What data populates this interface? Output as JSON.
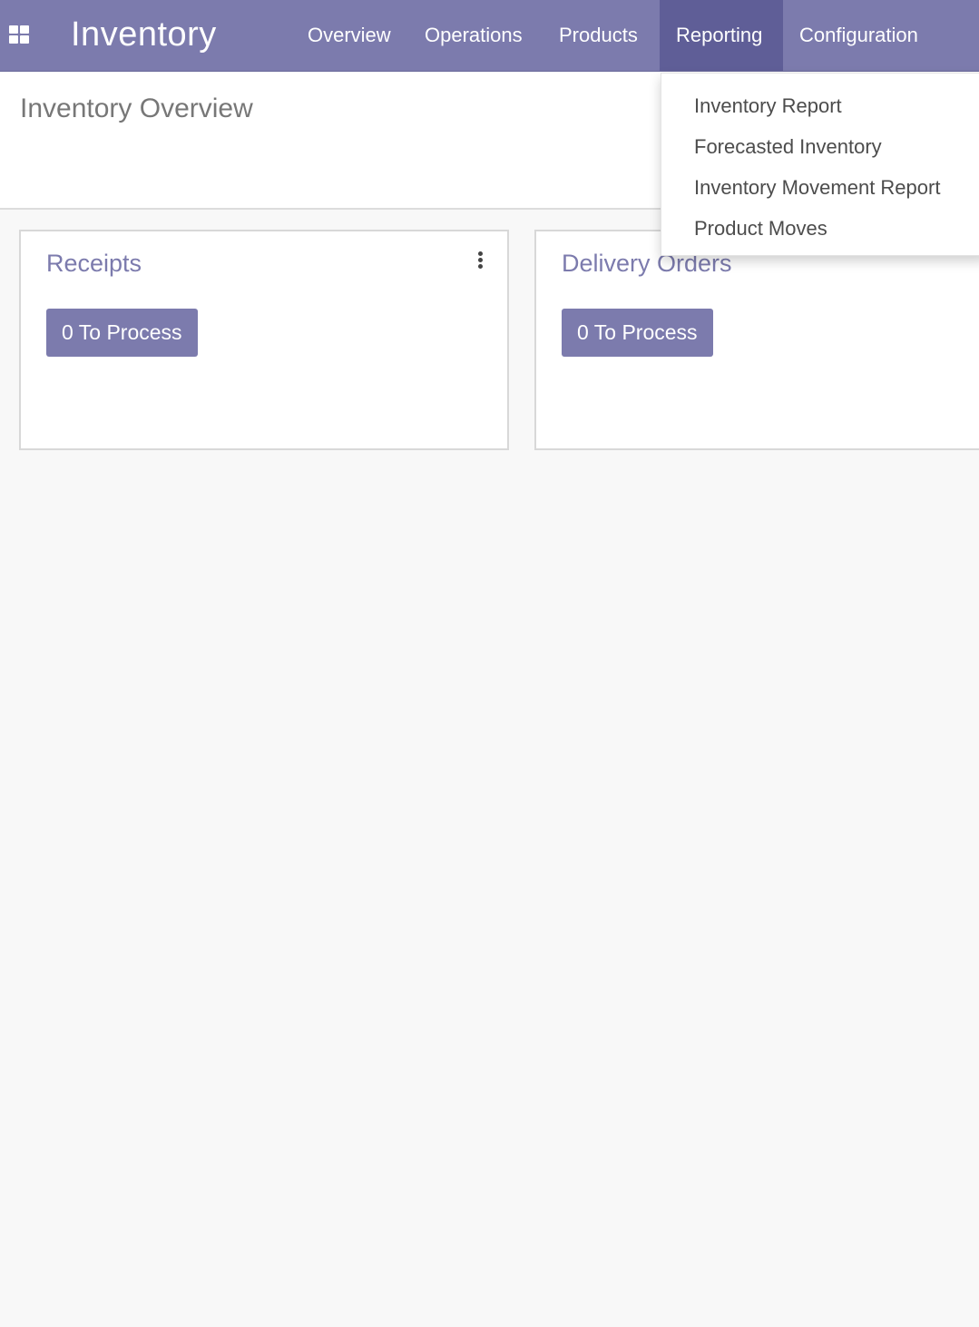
{
  "navbar": {
    "app_name": "Inventory",
    "menu": [
      {
        "label": "Overview"
      },
      {
        "label": "Operations"
      },
      {
        "label": "Products"
      },
      {
        "label": "Reporting"
      },
      {
        "label": "Configuration"
      }
    ],
    "active_menu": "Reporting",
    "apps_icon": "grid-icon"
  },
  "page": {
    "title": "Inventory Overview"
  },
  "cards": [
    {
      "title": "Receipts",
      "button_label": "0 To Process",
      "menu_icon": "kebab-icon"
    },
    {
      "title": "Delivery Orders",
      "button_label": "0 To Process"
    }
  ],
  "reporting_dropdown": {
    "items": [
      {
        "label": "Inventory Report"
      },
      {
        "label": "Forecasted Inventory"
      },
      {
        "label": "Inventory Movement Report"
      },
      {
        "label": "Product Moves"
      }
    ]
  },
  "colors": {
    "brand": "#7c7bad",
    "brand_active": "#5f5e97",
    "background": "#f8f8f8"
  }
}
